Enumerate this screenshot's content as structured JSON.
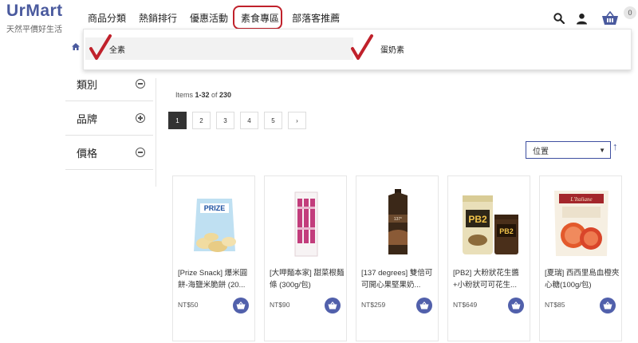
{
  "header": {
    "logo": "UrMart",
    "tagline": "天然平價好生活",
    "nav": [
      "商品分類",
      "熱銷排行",
      "優惠活動",
      "素食專區",
      "部落客推薦"
    ],
    "cart_count": "0"
  },
  "dropdown": {
    "items": [
      "全素",
      "蛋奶素"
    ]
  },
  "sidebar": {
    "filters": [
      {
        "label": "類別",
        "state": "expanded"
      },
      {
        "label": "品牌",
        "state": "collapsed"
      },
      {
        "label": "價格",
        "state": "expanded"
      }
    ]
  },
  "main": {
    "items_prefix": "Items ",
    "items_range": "1-32",
    "items_of": " of ",
    "items_total": "230",
    "pages": [
      "1",
      "2",
      "3",
      "4",
      "5",
      "›"
    ],
    "sort_label": "位置",
    "sort_caret": "▼",
    "sort_direction_arrow": "↑"
  },
  "products": [
    {
      "name": "[Prize Snack] 爆米圓餅-海鹽米脆餅 (20...",
      "price": "NT$50"
    },
    {
      "name": "[大呷麵本家] 甜菜根麵條 (300g/包)",
      "price": "NT$90"
    },
    {
      "name": "[137 degrees] 雙倍可可開心果堅果奶...",
      "price": "NT$259"
    },
    {
      "name": "[PB2] 大粉狀花生醬+小粉狀可可花生...",
      "price": "NT$649"
    },
    {
      "name": "[夏瑞] 西西里島血橙夾心糖(100g/包)",
      "price": "NT$85"
    }
  ],
  "colors": {
    "brand": "#4a5a9e",
    "cart_button": "#5160ab",
    "highlight": "#c0212b"
  }
}
